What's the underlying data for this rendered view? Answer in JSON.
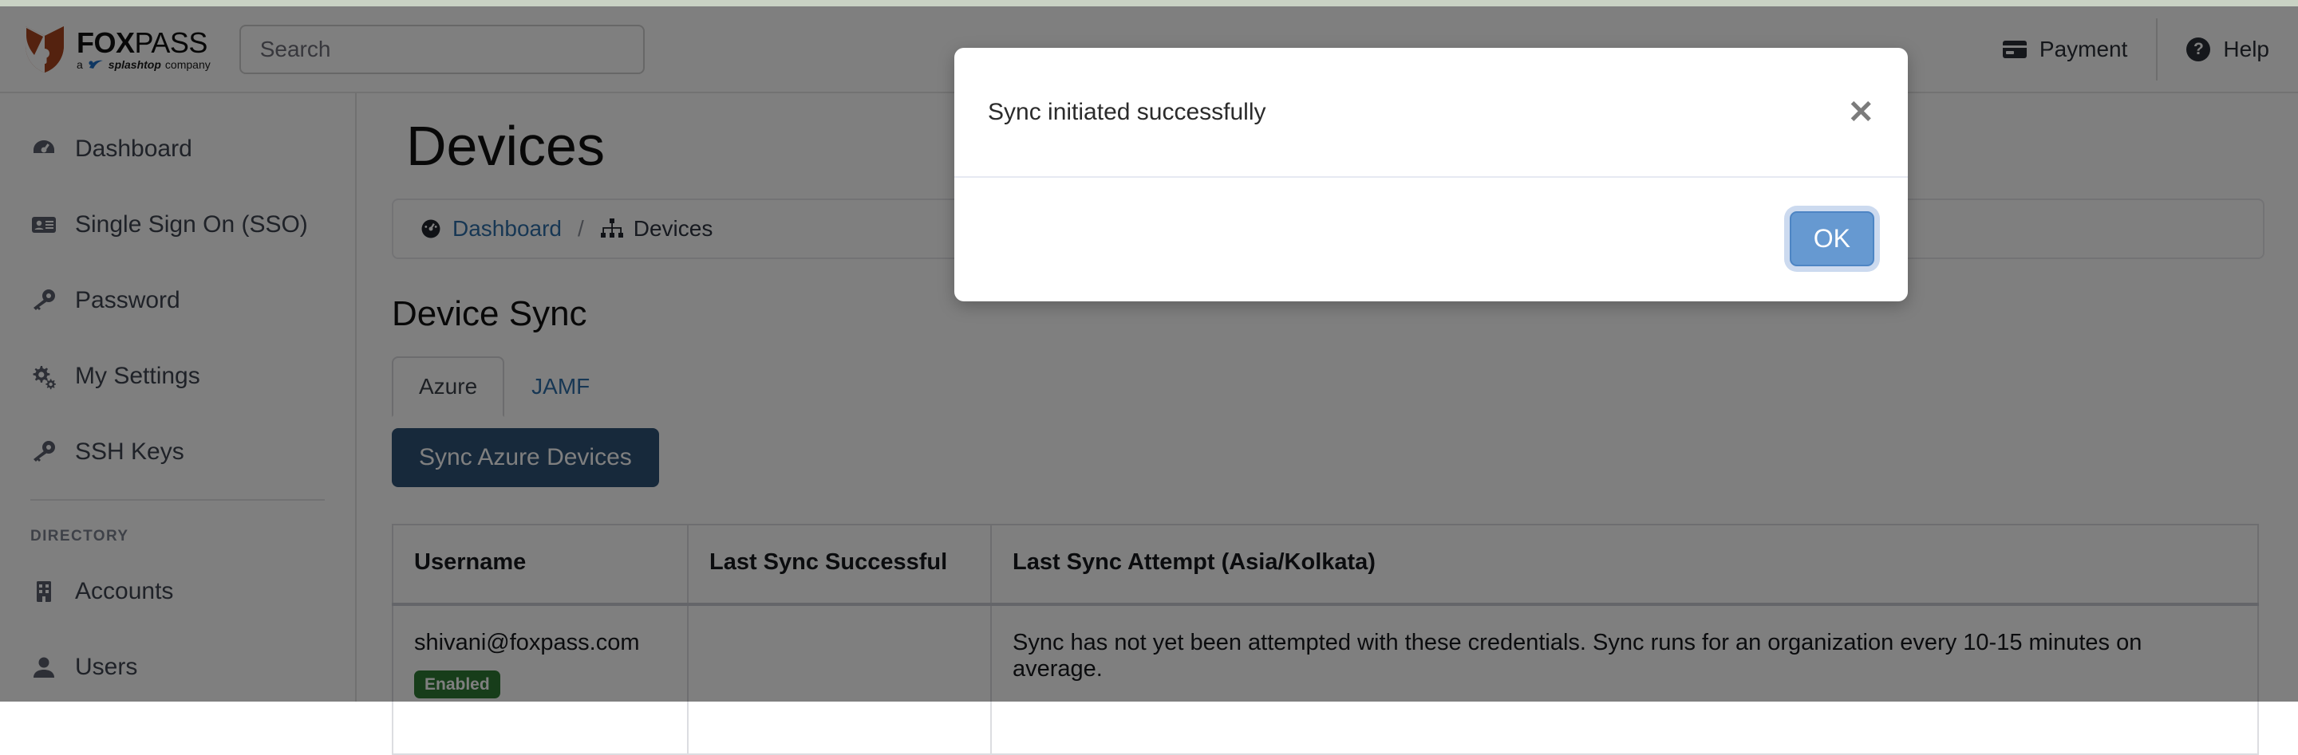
{
  "header": {
    "brand": {
      "name_bold": "FOX",
      "name_light": "PASS",
      "tagline_prefix": "a",
      "tagline_company": "splashtop",
      "tagline_suffix": "company"
    },
    "search": {
      "placeholder": "Search",
      "value": ""
    },
    "payment_label": "Payment",
    "help_label": "Help"
  },
  "sidebar": {
    "items": [
      {
        "label": "Dashboard",
        "icon": "dashboard-icon"
      },
      {
        "label": "Single Sign On (SSO)",
        "icon": "id-card-icon"
      },
      {
        "label": "Password",
        "icon": "key-icon"
      },
      {
        "label": "My Settings",
        "icon": "gears-icon"
      },
      {
        "label": "SSH Keys",
        "icon": "key-icon"
      }
    ],
    "group_title": "DIRECTORY",
    "group_items": [
      {
        "label": "Accounts",
        "icon": "building-icon"
      },
      {
        "label": "Users",
        "icon": "user-icon"
      }
    ]
  },
  "main": {
    "page_title": "Devices",
    "breadcrumb": {
      "home_label": "Dashboard",
      "separator": "/",
      "current_label": "Devices"
    },
    "section_title": "Device Sync",
    "tabs": [
      {
        "label": "Azure",
        "active": true
      },
      {
        "label": "JAMF",
        "active": false
      }
    ],
    "sync_button_label": "Sync Azure Devices",
    "table": {
      "columns": [
        "Username",
        "Last Sync Successful",
        "Last Sync Attempt (Asia/Kolkata)"
      ],
      "rows": [
        {
          "username": "shivani@foxpass.com",
          "status_badge": "Enabled",
          "last_sync_successful": "",
          "last_sync_attempt": "Sync has not yet been attempted with these credentials. Sync runs for an organization every 10-15 minutes on average."
        }
      ]
    }
  },
  "modal": {
    "message": "Sync initiated successfully",
    "close_label": "✕",
    "ok_label": "OK"
  },
  "colors": {
    "brand_shield": "#a8441f",
    "link": "#2f6fa8",
    "primary_button": "#2f5377",
    "ok_button": "#6699d1",
    "badge_enabled": "#2f7a34"
  }
}
